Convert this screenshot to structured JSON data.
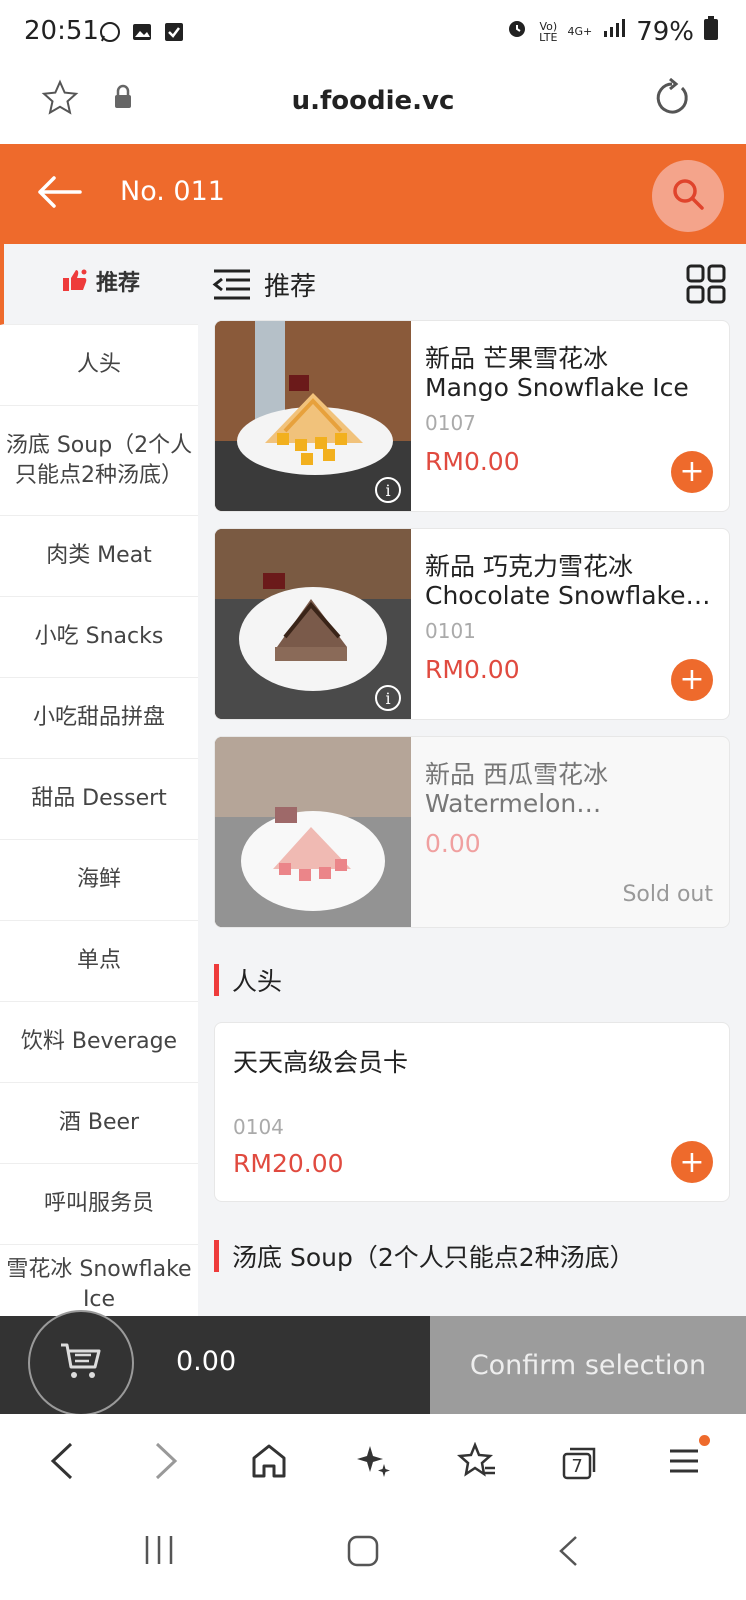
{
  "status_bar": {
    "time": "20:51",
    "network_label_top": "Vo)",
    "network_label_bottom": "LTE",
    "signal_label": "4G+",
    "battery": "79%"
  },
  "browser": {
    "url": "u.foodie.vc",
    "tab_count": "7"
  },
  "header": {
    "title": "No. 011"
  },
  "sidebar": {
    "items": [
      {
        "label": "推荐"
      },
      {
        "label": "人头"
      },
      {
        "label": "汤底 Soup（2个人只能点2种汤底）"
      },
      {
        "label": "肉类 Meat"
      },
      {
        "label": "小吃 Snacks"
      },
      {
        "label": "小吃甜品拼盘"
      },
      {
        "label": "甜品 Dessert"
      },
      {
        "label": "海鲜"
      },
      {
        "label": "单点"
      },
      {
        "label": "饮料 Beverage"
      },
      {
        "label": "酒 Beer"
      },
      {
        "label": "呼叫服务员"
      },
      {
        "label": "雪花冰 Snowflake Ice"
      }
    ]
  },
  "main": {
    "section_title": "推荐",
    "products": [
      {
        "name_cn": "新品 芒果雪花冰",
        "name_en": "Mango Snowflake Ice",
        "code": "0107",
        "price": "RM0.00",
        "add": "+",
        "info": "i"
      },
      {
        "name_cn": "新品 巧克力雪花冰",
        "name_en": "Chocolate Snowflake Ice",
        "code": "0101",
        "price": "RM0.00",
        "add": "+",
        "info": "i"
      },
      {
        "name_cn": "新品 西瓜雪花冰",
        "name_en": "Watermelon…",
        "price": "0.00",
        "status": "Sold out"
      }
    ],
    "section2_title": "人头",
    "product2": {
      "name_cn": "天天高级会员卡",
      "code": "0104",
      "price": "RM20.00",
      "add": "+"
    },
    "section3_title": "汤底 Soup（2个人只能点2种汤底）"
  },
  "cart": {
    "total": "0.00",
    "confirm_label": "Confirm selection"
  },
  "colors": {
    "accent": "#ee6a2c",
    "price": "#e04a3f",
    "cart_bar": "#333333",
    "confirm_bg": "#9c9c9c"
  }
}
